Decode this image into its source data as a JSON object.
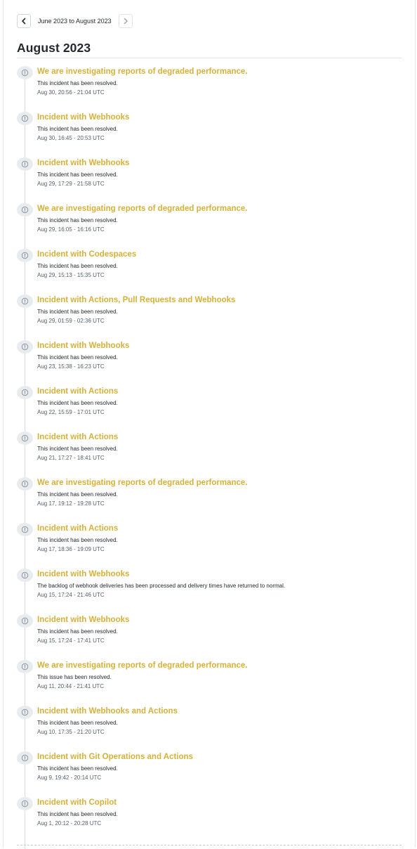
{
  "pager": {
    "prev_icon": "chevron-left-icon",
    "next_icon": "chevron-right-icon",
    "range_label": "June 2023 to August 2023"
  },
  "month": {
    "title": "August 2023"
  },
  "colors": {
    "incident_title": "#d6b13a",
    "icon_bg": "#e8ecef",
    "timeline": "#d8dde3"
  },
  "incidents": [
    {
      "title": "We are investigating reports of degraded performance.",
      "message": "This incident has been resolved.",
      "time": "Aug 30, 20:56 - 21:04 UTC"
    },
    {
      "title": "Incident with Webhooks",
      "message": "This incident has been resolved.",
      "time": "Aug 30, 16:45 - 20:53 UTC"
    },
    {
      "title": "Incident with Webhooks",
      "message": "This incident has been resolved.",
      "time": "Aug 29, 17:29 - 21:58 UTC"
    },
    {
      "title": "We are investigating reports of degraded performance.",
      "message": "This incident has been resolved.",
      "time": "Aug 29, 16:05 - 16:16 UTC"
    },
    {
      "title": "Incident with Codespaces",
      "message": "This incident has been resolved.",
      "time": "Aug 29, 15:13 - 15:35 UTC"
    },
    {
      "title": "Incident with Actions, Pull Requests and Webhooks",
      "message": "This incident has been resolved.",
      "time": "Aug 29, 01:59 - 02:36 UTC"
    },
    {
      "title": "Incident with Webhooks",
      "message": "This incident has been resolved.",
      "time": "Aug 23, 15:38 - 16:23 UTC"
    },
    {
      "title": "Incident with Actions",
      "message": "This incident has been resolved.",
      "time": "Aug 22, 15:59 - 17:01 UTC"
    },
    {
      "title": "Incident with Actions",
      "message": "This incident has been resolved.",
      "time": "Aug 21, 17:27 - 18:41 UTC"
    },
    {
      "title": "We are investigating reports of degraded performance.",
      "message": "This incident has been resolved.",
      "time": "Aug 17, 19:12 - 19:28 UTC"
    },
    {
      "title": "Incident with Actions",
      "message": "This incident has been resolved.",
      "time": "Aug 17, 18:36 - 19:09 UTC"
    },
    {
      "title": "Incident with Webhooks",
      "message": "The backlog of webhook deliveries has been processed and delivery times have returned to normal.",
      "time": "Aug 15, 17:24 - 21:46 UTC"
    },
    {
      "title": "Incident with Webhooks",
      "message": "This incident has been resolved.",
      "time": "Aug 15, 17:24 - 17:41 UTC"
    },
    {
      "title": "We are investigating reports of degraded performance.",
      "message": "This issue has been resolved.",
      "time": "Aug 11, 20:44 - 21:41 UTC"
    },
    {
      "title": "Incident with Webhooks and Actions",
      "message": "This incident has been resolved.",
      "time": "Aug 10, 17:35 - 21:20 UTC"
    },
    {
      "title": "Incident with Git Operations and Actions",
      "message": "This incident has been resolved.",
      "time": "Aug 9, 19:42 - 20:14 UTC"
    },
    {
      "title": "Incident with Copilot",
      "message": "This incident has been resolved.",
      "time": "Aug 1, 20:12 - 20:28 UTC"
    }
  ]
}
